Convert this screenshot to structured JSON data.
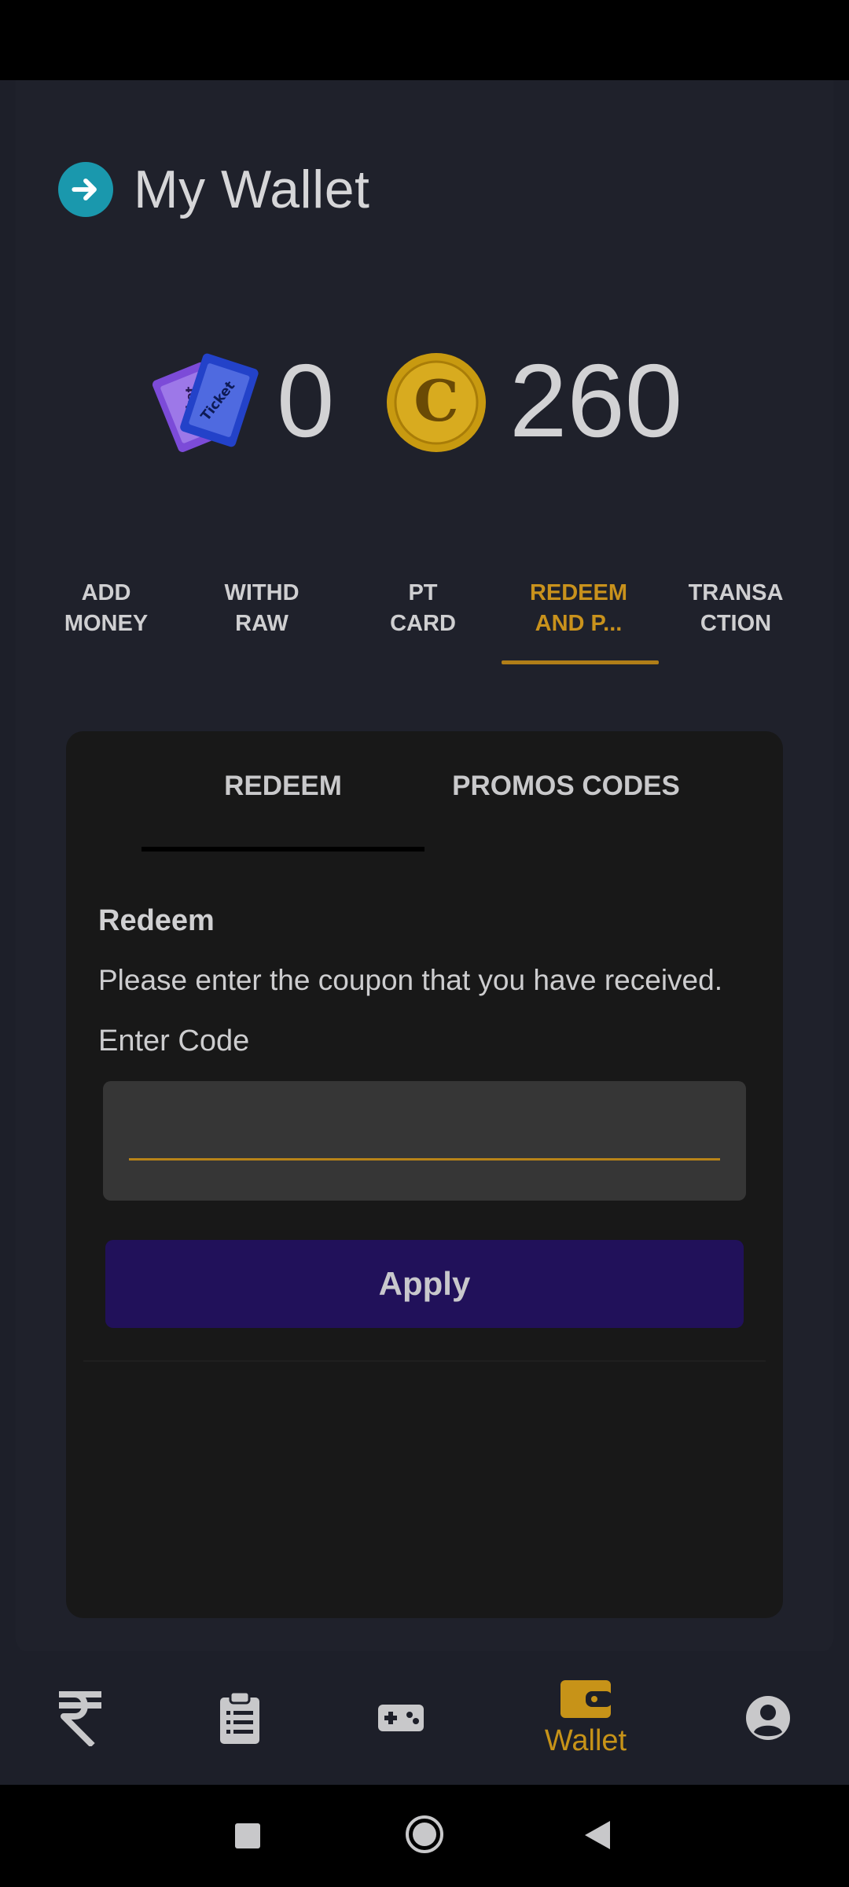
{
  "header": {
    "title": "My Wallet",
    "back_icon": "arrow-right-circle-icon"
  },
  "balances": {
    "ticket_label": "Ticket",
    "ticket_count": "0",
    "coin_letter": "C",
    "coin_count": "260"
  },
  "tabs": [
    {
      "line1": "ADD",
      "line2": "MONEY",
      "active": false
    },
    {
      "line1": "WITHD",
      "line2": "RAW",
      "active": false
    },
    {
      "line1": "PT",
      "line2": "CARD",
      "active": false
    },
    {
      "line1": "REDEEM",
      "line2": "AND P...",
      "active": true
    },
    {
      "line1": "TRANSA",
      "line2": "CTION",
      "active": false
    }
  ],
  "subtabs": [
    {
      "label": "REDEEM",
      "active": true
    },
    {
      "label": "PROMOS CODES",
      "active": false
    }
  ],
  "redeem": {
    "title": "Redeem",
    "description": "Please enter the coupon that you have received.",
    "field_label": "Enter Code",
    "code_value": "",
    "apply_label": "Apply"
  },
  "bottom_nav": [
    {
      "icon": "rupee-icon",
      "label": ""
    },
    {
      "icon": "clipboard-list-icon",
      "label": ""
    },
    {
      "icon": "gamepad-icon",
      "label": ""
    },
    {
      "icon": "wallet-icon",
      "label": "Wallet",
      "active": true
    },
    {
      "icon": "account-circle-icon",
      "label": ""
    }
  ],
  "colors": {
    "background": "#1d1f29",
    "accent": "#c9921c",
    "card": "#181818",
    "button": "#21115a",
    "back_button": "#1a98ad"
  }
}
